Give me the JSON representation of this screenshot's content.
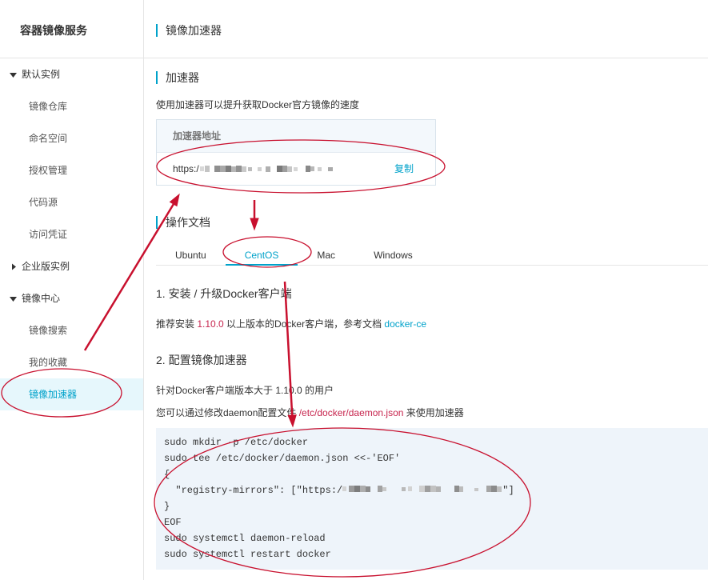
{
  "colors": {
    "accent": "#00a2ca",
    "brand_orange": "#ff6a00",
    "highlight_red": "#c7254e",
    "annotation_red": "#c8102e",
    "active_row_bg": "#e6f7fc",
    "code_bg": "#eef4fa"
  },
  "sidebar": {
    "title": "容器镜像服务",
    "items": [
      {
        "label": "默认实例",
        "is_group": true,
        "expanded": true,
        "icon": "caret-down-icon"
      },
      {
        "label": "镜像仓库"
      },
      {
        "label": "命名空间"
      },
      {
        "label": "授权管理"
      },
      {
        "label": "代码源"
      },
      {
        "label": "访问凭证"
      },
      {
        "label": "企业版实例",
        "is_group": true,
        "expanded": false,
        "icon": "caret-right-icon"
      },
      {
        "label": "镜像中心",
        "is_group": true,
        "expanded": true,
        "icon": "caret-down-icon"
      },
      {
        "label": "镜像搜索"
      },
      {
        "label": "我的收藏"
      },
      {
        "label": "镜像加速器",
        "active": true
      }
    ]
  },
  "header": {
    "title": "镜像加速器"
  },
  "accelerator": {
    "section_title": "加速器",
    "description": "使用加速器可以提升获取Docker官方镜像的速度",
    "address_header": "加速器地址",
    "address_visible_prefix": "https:/",
    "address_redacted": true,
    "copy_label": "复制"
  },
  "docs": {
    "section_title": "操作文档",
    "tabs": [
      {
        "label": "Ubuntu"
      },
      {
        "label": "CentOS",
        "active": true
      },
      {
        "label": "Mac"
      },
      {
        "label": "Windows"
      }
    ],
    "step1": {
      "title": "1. 安装 / 升级Docker客户端",
      "text_before": "推荐安装 ",
      "version": "1.10.0",
      "text_after": " 以上版本的Docker客户端，参考文档 ",
      "link": "docker-ce"
    },
    "step2": {
      "title": "2. 配置镜像加速器",
      "line1": "针对Docker客户端版本大于 1.10.0 的用户",
      "line2_before": "您可以通过修改daemon配置文件 ",
      "path": "/etc/docker/daemon.json",
      "line2_after": " 来使用加速器"
    },
    "code": {
      "lines": [
        {
          "text": "sudo mkdir -p /etc/docker"
        },
        {
          "text": "sudo tee /etc/docker/daemon.json <<-'EOF'"
        },
        {
          "text": "{"
        },
        {
          "text": "  \"registry-mirrors\": [\"https:/",
          "suffix": "\"]",
          "redacted": true
        },
        {
          "text": "}"
        },
        {
          "text": "EOF"
        },
        {
          "text": "sudo systemctl daemon-reload"
        },
        {
          "text": "sudo systemctl restart docker"
        }
      ]
    }
  }
}
